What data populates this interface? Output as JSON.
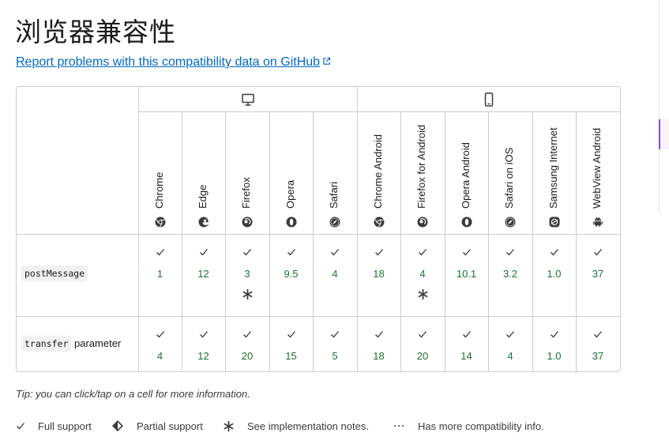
{
  "page": {
    "title": "浏览器兼容性",
    "github_link": "Report problems with this compatibility data on GitHub",
    "tip": "Tip: you can click/tap on a cell for more information."
  },
  "platforms": [
    {
      "name": "desktop",
      "icon": "desktop-icon"
    },
    {
      "name": "mobile",
      "icon": "mobile-icon"
    }
  ],
  "browsers": [
    {
      "name": "Chrome",
      "icon": "chrome-icon"
    },
    {
      "name": "Edge",
      "icon": "edge-icon"
    },
    {
      "name": "Firefox",
      "icon": "firefox-icon"
    },
    {
      "name": "Opera",
      "icon": "opera-icon"
    },
    {
      "name": "Safari",
      "icon": "safari-icon"
    },
    {
      "name": "Chrome Android",
      "icon": "chrome-icon"
    },
    {
      "name": "Firefox for Android",
      "icon": "firefox-icon"
    },
    {
      "name": "Opera Android",
      "icon": "opera-icon"
    },
    {
      "name": "Safari on iOS",
      "icon": "safari-icon"
    },
    {
      "name": "Samsung Internet",
      "icon": "samsung-internet-icon"
    },
    {
      "name": "WebView Android",
      "icon": "android-icon"
    }
  ],
  "features": [
    {
      "code": "postMessage",
      "suffix": "",
      "versions": [
        "1",
        "12",
        "3",
        "9.5",
        "4",
        "18",
        "4",
        "10.1",
        "3.2",
        "1.0",
        "37"
      ],
      "notes": [
        false,
        false,
        true,
        false,
        false,
        false,
        true,
        false,
        false,
        false,
        false
      ]
    },
    {
      "code": "transfer",
      "suffix": "parameter",
      "versions": [
        "4",
        "12",
        "20",
        "15",
        "5",
        "18",
        "20",
        "14",
        "4",
        "1.0",
        "37"
      ],
      "notes": [
        false,
        false,
        false,
        false,
        false,
        false,
        false,
        false,
        false,
        false,
        false
      ]
    }
  ],
  "legend": [
    {
      "label": "Full support",
      "icon": "check-icon"
    },
    {
      "label": "Partial support",
      "icon": "partial-icon"
    },
    {
      "label": "See implementation notes.",
      "icon": "asterisk-icon"
    },
    {
      "label": "Has more compatibility info.",
      "icon": "more-icon"
    }
  ],
  "colors": {
    "link": "#0069c2",
    "version": "#1e7132",
    "border": "#cdcdcd"
  }
}
